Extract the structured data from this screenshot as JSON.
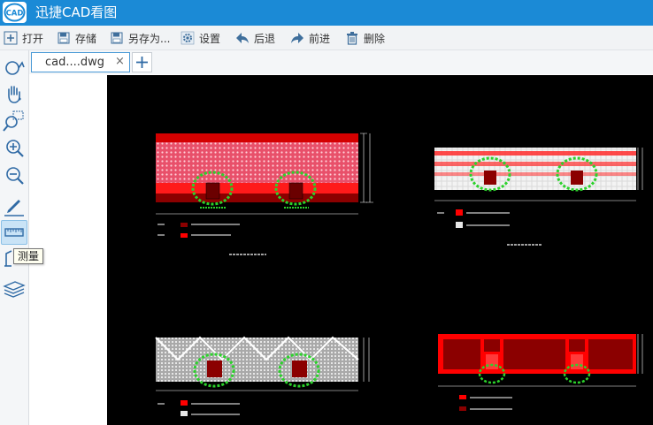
{
  "app": {
    "logo_text": "CAD",
    "title": "迅捷CAD看图"
  },
  "toolbar": {
    "open": "打开",
    "save": "存储",
    "save_as": "另存为...",
    "settings": "设置",
    "back": "后退",
    "forward": "前进",
    "delete": "删除"
  },
  "tabs": {
    "active_file": "cad....dwg",
    "close_glyph": "×",
    "new_tab_glyph": "+"
  },
  "tools": [
    {
      "icon": "rotate-view-icon"
    },
    {
      "icon": "pan-hand-icon"
    },
    {
      "icon": "zoom-window-icon"
    },
    {
      "icon": "zoom-in-icon"
    },
    {
      "icon": "zoom-out-icon"
    },
    {
      "icon": "draw-pen-icon"
    },
    {
      "icon": "measure-ruler-icon",
      "active": true
    },
    {
      "icon": "annotate-icon"
    },
    {
      "icon": "layers-icon"
    }
  ],
  "tooltip": {
    "text": "测量"
  },
  "drawing": {
    "colors": {
      "canvas": "#000000",
      "red": "#ff0000",
      "dark_red": "#8b0000",
      "white": "#ffffff",
      "gray": "#bfbfbf",
      "green": "#2bd22b"
    }
  }
}
